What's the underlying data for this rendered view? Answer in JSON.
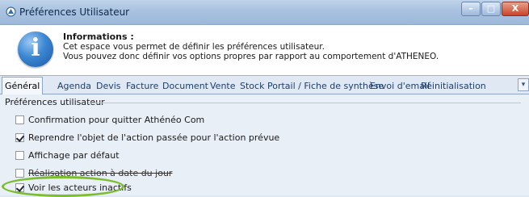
{
  "window": {
    "title": "Préférences Utilisateur",
    "minimize": "–",
    "maximize": "□",
    "close": "X"
  },
  "info": {
    "title": "Informations :",
    "line1": "Cet espace vous permet de définir les préférences utilisateur.",
    "line2": "Vous pouvez donc définir vos options propres par rapport au comportement d'ATHENEO.",
    "icon_glyph": "i"
  },
  "tabs": [
    {
      "label": "Général",
      "active": true
    },
    {
      "label": "Agenda"
    },
    {
      "label": "Devis"
    },
    {
      "label": "Facture"
    },
    {
      "label": "Document"
    },
    {
      "label": "Vente"
    },
    {
      "label": "Stock"
    },
    {
      "label": "Portail / Fiche de synthèse"
    },
    {
      "label": "Envoi d'email"
    },
    {
      "label": "Réinitialisation"
    }
  ],
  "tab_scroll_glyph": "▾",
  "group": {
    "title": "Préférences utilisateur",
    "options": [
      {
        "label": "Confirmation pour quitter Athénéo Com",
        "checked": false
      },
      {
        "label": "Reprendre l'objet de l'action passée pour l'action prévue",
        "checked": true
      },
      {
        "label": "Affichage par défaut",
        "checked": false
      },
      {
        "label": "Réalisation action à date du jour",
        "checked": false
      },
      {
        "label": "Voir les acteurs inactifs",
        "checked": true
      }
    ]
  },
  "colors": {
    "highlight": "#7cbd2c",
    "titlebar": "#a9c2e0",
    "close_button": "#c9432a"
  }
}
